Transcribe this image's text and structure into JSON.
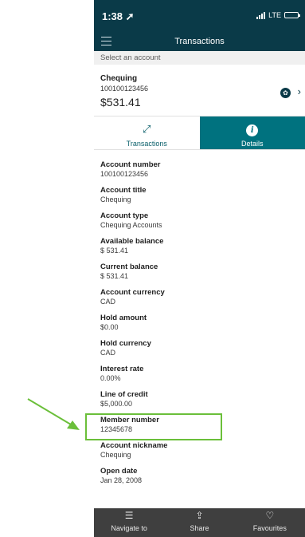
{
  "status_bar": {
    "time": "1:38",
    "network": "LTE"
  },
  "nav": {
    "title": "Transactions"
  },
  "account_selector": {
    "prompt": "Select an account"
  },
  "account": {
    "name": "Chequing",
    "number": "100100123456",
    "balance": "$531.41"
  },
  "tabs": [
    {
      "label": "Transactions",
      "icon": "expand-arrows-icon",
      "active": false
    },
    {
      "label": "Details",
      "icon": "info-icon",
      "active": true
    }
  ],
  "details": [
    {
      "label": "Account number",
      "value": "100100123456"
    },
    {
      "label": "Account title",
      "value": "Chequing"
    },
    {
      "label": "Account type",
      "value": "Chequing Accounts"
    },
    {
      "label": "Available balance",
      "value": "$ 531.41"
    },
    {
      "label": "Current balance",
      "value": "$ 531.41"
    },
    {
      "label": "Account currency",
      "value": "CAD"
    },
    {
      "label": "Hold amount",
      "value": "$0.00"
    },
    {
      "label": "Hold currency",
      "value": "CAD"
    },
    {
      "label": "Interest rate",
      "value": "0.00%"
    },
    {
      "label": "Line of credit",
      "value": "$5,000.00"
    },
    {
      "label": "Member number",
      "value": "12345678"
    },
    {
      "label": "Account nickname",
      "value": "Chequing"
    },
    {
      "label": "Open date",
      "value": "Jan 28, 2008"
    }
  ],
  "bottom_bar": [
    {
      "label": "Navigate to",
      "icon": "list-icon"
    },
    {
      "label": "Share",
      "icon": "share-icon"
    },
    {
      "label": "Favourites",
      "icon": "heart-icon"
    }
  ],
  "colors": {
    "header": "#0a3a48",
    "accent": "#00727f",
    "highlight": "#6bbf3a",
    "bottom_bar": "#3f3f3f"
  }
}
